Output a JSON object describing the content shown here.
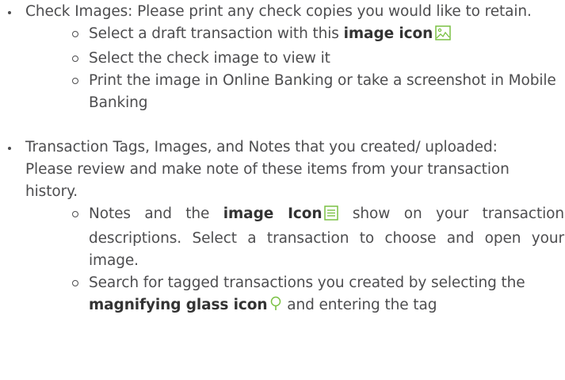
{
  "section_check_images": {
    "intro": "Check Images: Please print any check copies you would like to retain.",
    "sub1_text": "Select a draft transaction with this ",
    "sub1_bold": "image icon",
    "sub2_text": "Select the check image to view it",
    "sub3_text": "Print the image in Online Banking or take a screenshot in Mobile Banking"
  },
  "section_transaction_tags": {
    "intro": "Transaction Tags, Images, and Notes that you created/ uploaded: Please review and make note of these items from your transaction history.",
    "sub1_text_before": "Notes and the ",
    "sub1_bold": "image Icon",
    "sub1_text_after": " show on your transaction descriptions. Select a transaction to choose and open your image.",
    "sub2_text_before": "Search for tagged transactions you created by selecting the ",
    "sub2_bold": "magnifying glass icon",
    "sub2_text_after": " and entering the tag"
  },
  "colors": {
    "text": "#4d4d4f",
    "icon_green": "#7ac143"
  }
}
